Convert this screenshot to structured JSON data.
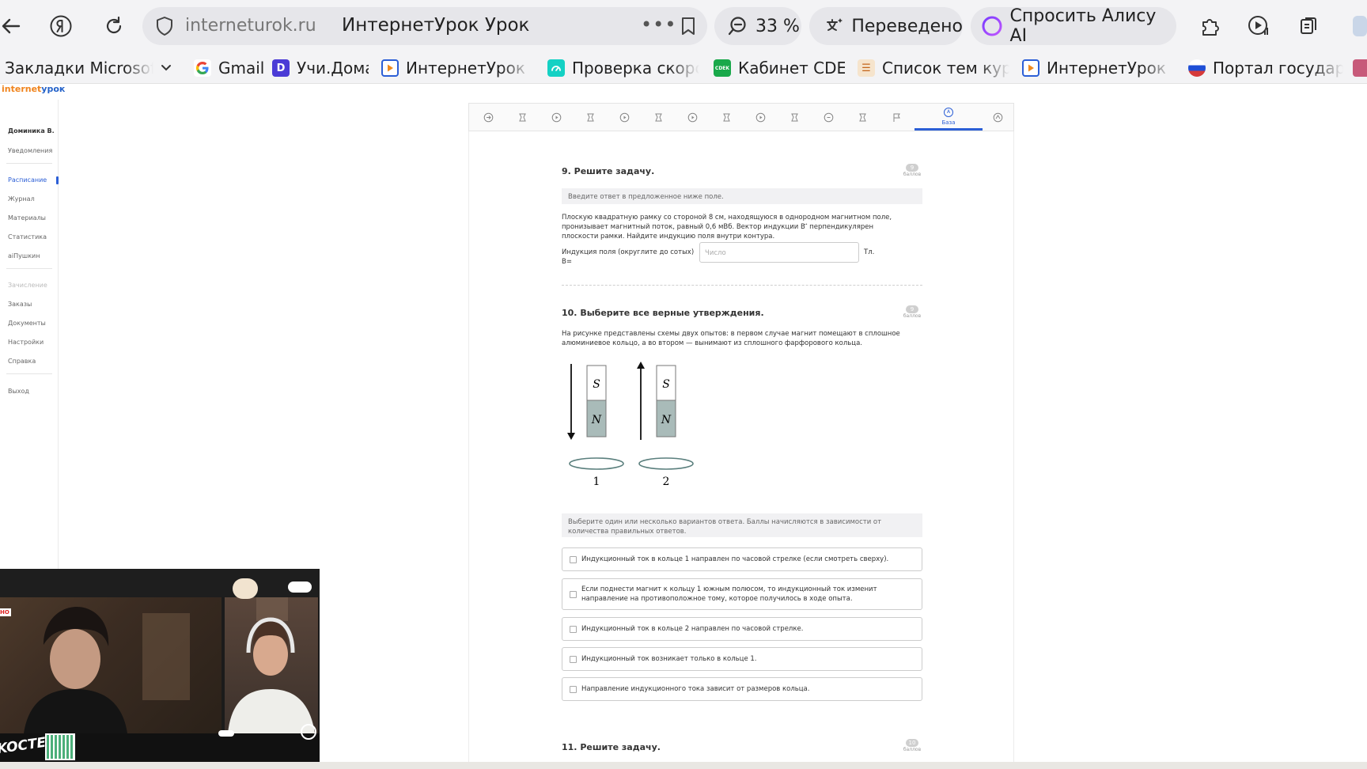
{
  "browser": {
    "host": "interneturok.ru",
    "page_title": "ИнтернетУрок Урок",
    "zoom": "33 %",
    "translated_label": "Переведено",
    "alice_label": "Спросить Алису AI"
  },
  "bookmarks": [
    {
      "label": "Закладки Microsoft E",
      "color": "#f3c331"
    },
    {
      "label": "Gmail",
      "color": "#ea4335"
    },
    {
      "label": "Учи.Дома",
      "color": "#4b3bd6"
    },
    {
      "label": "ИнтернетУрок Ра",
      "color": "#2c5fd6"
    },
    {
      "label": "Проверка скорос",
      "color": "#14d1c4"
    },
    {
      "label": "Кабинет CDEK",
      "color": "#19a84a"
    },
    {
      "label": "Список тем курса",
      "color": "#f08a1d"
    },
    {
      "label": "ИнтернетУрок Ра",
      "color": "#2c5fd6"
    },
    {
      "label": "Портал государс",
      "color": "#d63a3a"
    }
  ],
  "site": {
    "logo_a": "internet",
    "logo_b": "урок"
  },
  "sidebar": {
    "user": "Доминика В.",
    "items": [
      "Уведомления",
      "Расписание",
      "Журнал",
      "Материалы",
      "Статистика",
      "аіПушкин",
      "Зачисление",
      "Заказы",
      "Документы",
      "Настройки",
      "Справка",
      "Выход"
    ]
  },
  "qnav": {
    "base_label": "База"
  },
  "q9": {
    "title": "9. Решите задачу.",
    "points": "9",
    "points_label": "баллов",
    "hint": "Введите ответ в предложенное ниже поле.",
    "body": "Плоскую квадратную рамку со стороной 8 см, находящуюся в однородном магнитном поле, пронизывает магнитный поток, равный 0,6 мВб. Вектор индукции В ⃗ перпендикулярен плоскости рамки. Найдите индукцию поля внутри контура.",
    "answer_label": "Индукция поля (округлите до сотых) B=",
    "answer_placeholder": "Число",
    "unit": "Тл."
  },
  "q10": {
    "title": "10. Выберите все верные утверждения.",
    "points": "9",
    "points_label": "баллов",
    "body": "На рисунке представлены схемы двух опытов: в первом случае магнит помещают в сплошное алюминиевое кольцо, а во втором — вынимают из сплошного фарфорового кольца.",
    "figure": {
      "pole_s": "S",
      "pole_n": "N",
      "label_1": "1",
      "label_2": "2"
    },
    "hint": "Выберите один или несколько вариантов ответа. Баллы начисляются в зависимости от количества правильных ответов.",
    "options": [
      "Индукционный ток в кольце 1 направлен по часовой стрелке (если смотреть сверху).",
      "Если поднести магнит к кольцу 1 южным полюсом, то индукционный ток изменит направление на противоположное тому, которое получилось в ходе опыта.",
      "Индукционный ток в кольце 2 направлен по часовой стрелке.",
      "Индукционный ток возникает только в кольце 1.",
      "Направление индукционного тока зависит от размеров кольца."
    ]
  },
  "q11": {
    "title": "11. Решите задачу.",
    "points": "10",
    "points_label": "баллов"
  },
  "overlay": {
    "badge": "HO",
    "sticker": "KOCTEK"
  }
}
